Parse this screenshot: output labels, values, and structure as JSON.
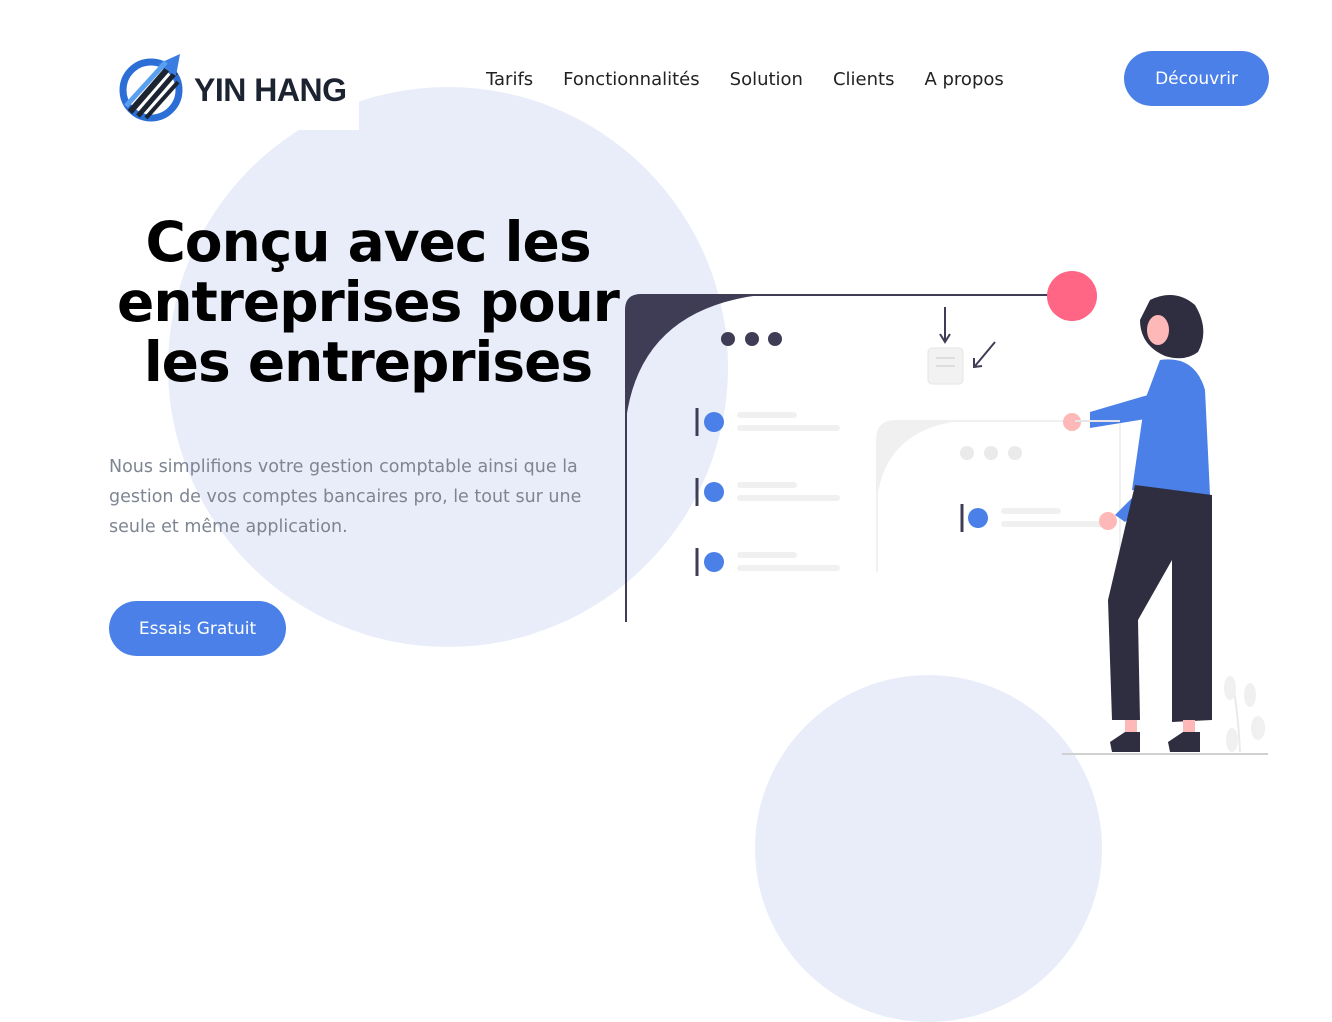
{
  "brand": {
    "name": "YIN HANG"
  },
  "nav": {
    "items": [
      "Tarifs",
      "Fonctionnalités",
      "Solution",
      "Clients",
      "A propos"
    ]
  },
  "header": {
    "cta_label": "Découvrir"
  },
  "hero": {
    "title": "Conçu avec les entreprises pour les entreprises",
    "subtitle": "Nous simplifions votre gestion comptable ainsi que la gestion de vos comptes bancaires pro, le tout sur une seule et même application.",
    "cta_label": "Essais Gratuit"
  },
  "colors": {
    "accent": "#4a80e8",
    "circle_bg": "#e8edf9",
    "dark": "#3f3d56",
    "pink": "#ff6584",
    "text_muted": "#7e8592"
  },
  "icons": [
    "logo-arrow-icon",
    "hero-illustration"
  ]
}
